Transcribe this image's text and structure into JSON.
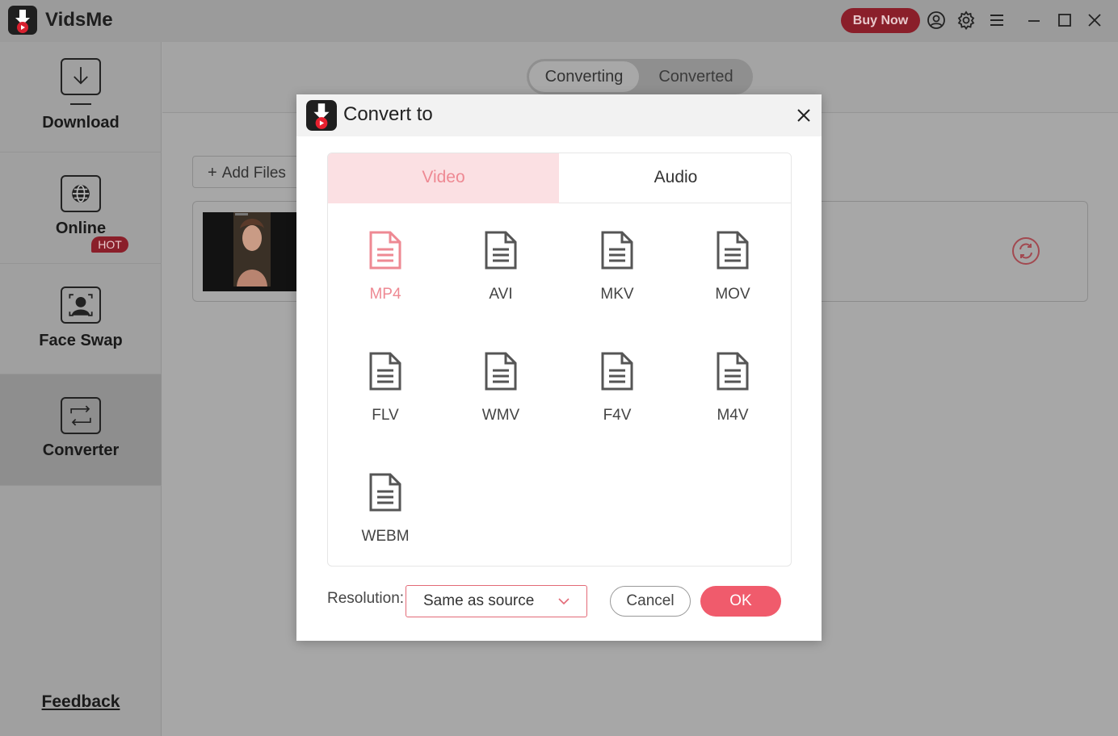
{
  "app": {
    "name": "VidsMe"
  },
  "titlebar": {
    "buy_now": "Buy Now",
    "icons": [
      "account-icon",
      "settings-icon",
      "menu-icon",
      "minimize-icon",
      "maximize-icon",
      "close-icon"
    ]
  },
  "sidebar": {
    "items": [
      {
        "label": "Download",
        "icon": "download-icon"
      },
      {
        "label": "Online",
        "icon": "globe-icon"
      },
      {
        "label": "Face Swap",
        "icon": "face-swap-icon",
        "badge": "HOT"
      },
      {
        "label": "Converter",
        "icon": "converter-icon",
        "active": true
      }
    ],
    "feedback": "Feedback"
  },
  "main": {
    "tabs": [
      {
        "label": "Converting",
        "active": true
      },
      {
        "label": "Converted"
      }
    ],
    "add_files": "Add Files"
  },
  "dialog": {
    "title": "Convert to",
    "tabs": [
      {
        "label": "Video",
        "active": true
      },
      {
        "label": "Audio"
      }
    ],
    "formats": [
      "MP4",
      "AVI",
      "MKV",
      "MOV",
      "FLV",
      "WMV",
      "F4V",
      "M4V",
      "WEBM"
    ],
    "selected_format": "MP4",
    "resolution_label": "Resolution:",
    "resolution_value": "Same as source",
    "cancel": "Cancel",
    "ok": "OK"
  },
  "colors": {
    "accent": "#f05b6c",
    "accent_light": "#fbe0e3",
    "brand_dark": "#8a1f2a"
  }
}
